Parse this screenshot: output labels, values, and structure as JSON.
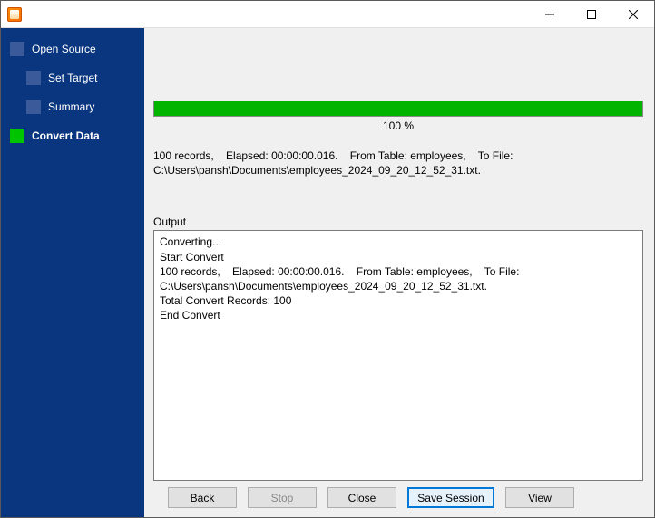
{
  "window": {
    "title": ""
  },
  "sidebar": {
    "steps": [
      {
        "label": "Open Source",
        "active": false,
        "sub": false
      },
      {
        "label": "Set Target",
        "active": false,
        "sub": true
      },
      {
        "label": "Summary",
        "active": false,
        "sub": true
      },
      {
        "label": "Convert Data",
        "active": true,
        "sub": false
      }
    ]
  },
  "progress": {
    "percent": 100,
    "label": "100 %"
  },
  "status_text": "100 records,    Elapsed: 00:00:00.016.    From Table: employees,    To File: C:\\Users\\pansh\\Documents\\employees_2024_09_20_12_52_31.txt.",
  "output": {
    "label": "Output",
    "text": "Converting...\nStart Convert\n100 records,    Elapsed: 00:00:00.016.    From Table: employees,    To File: C:\\Users\\pansh\\Documents\\employees_2024_09_20_12_52_31.txt.\nTotal Convert Records: 100\nEnd Convert"
  },
  "buttons": {
    "back": "Back",
    "stop": "Stop",
    "close": "Close",
    "save_session": "Save Session",
    "view": "View"
  }
}
